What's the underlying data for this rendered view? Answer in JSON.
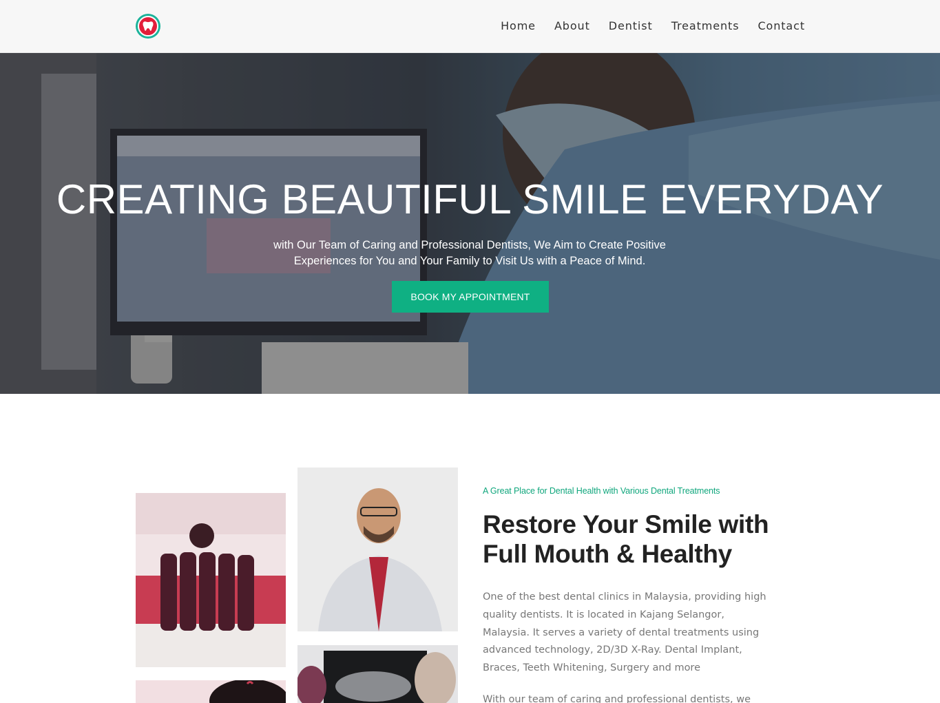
{
  "header": {
    "nav": [
      "Home",
      "About",
      "Dentist",
      "Treatments",
      "Contact"
    ]
  },
  "hero": {
    "title": "CREATING BEAUTIFUL SMILE EVERYDAY",
    "subtitle": "with Our Team of Caring and Professional Dentists, We Aim to Create Positive Experiences for You and Your Family to Visit Us with a Peace of Mind.",
    "button": "BOOK MY APPOINTMENT"
  },
  "about": {
    "tagline": "A Great Place for Dental Health with Various Dental Treatments",
    "heading": "Restore Your Smile with Full Mouth & Healthy",
    "paragraph": "One of the best dental clinics in Malaysia, providing high quality dentists. It is located in Kajang Selangor, Malaysia. It serves a variety of dental treatments using advanced technology, 2D/3D X-Ray. Dental Implant, Braces, Teeth Whitening, Surgery and more",
    "paragraph2": "With our team of caring and professional dentists, we aim to"
  },
  "colors": {
    "accent": "#0fb083",
    "tagline": "#0fa67c",
    "logo_red": "#e31e3a",
    "logo_teal": "#1bb39a"
  },
  "icons": {
    "logo": "tooth-logo-icon"
  }
}
